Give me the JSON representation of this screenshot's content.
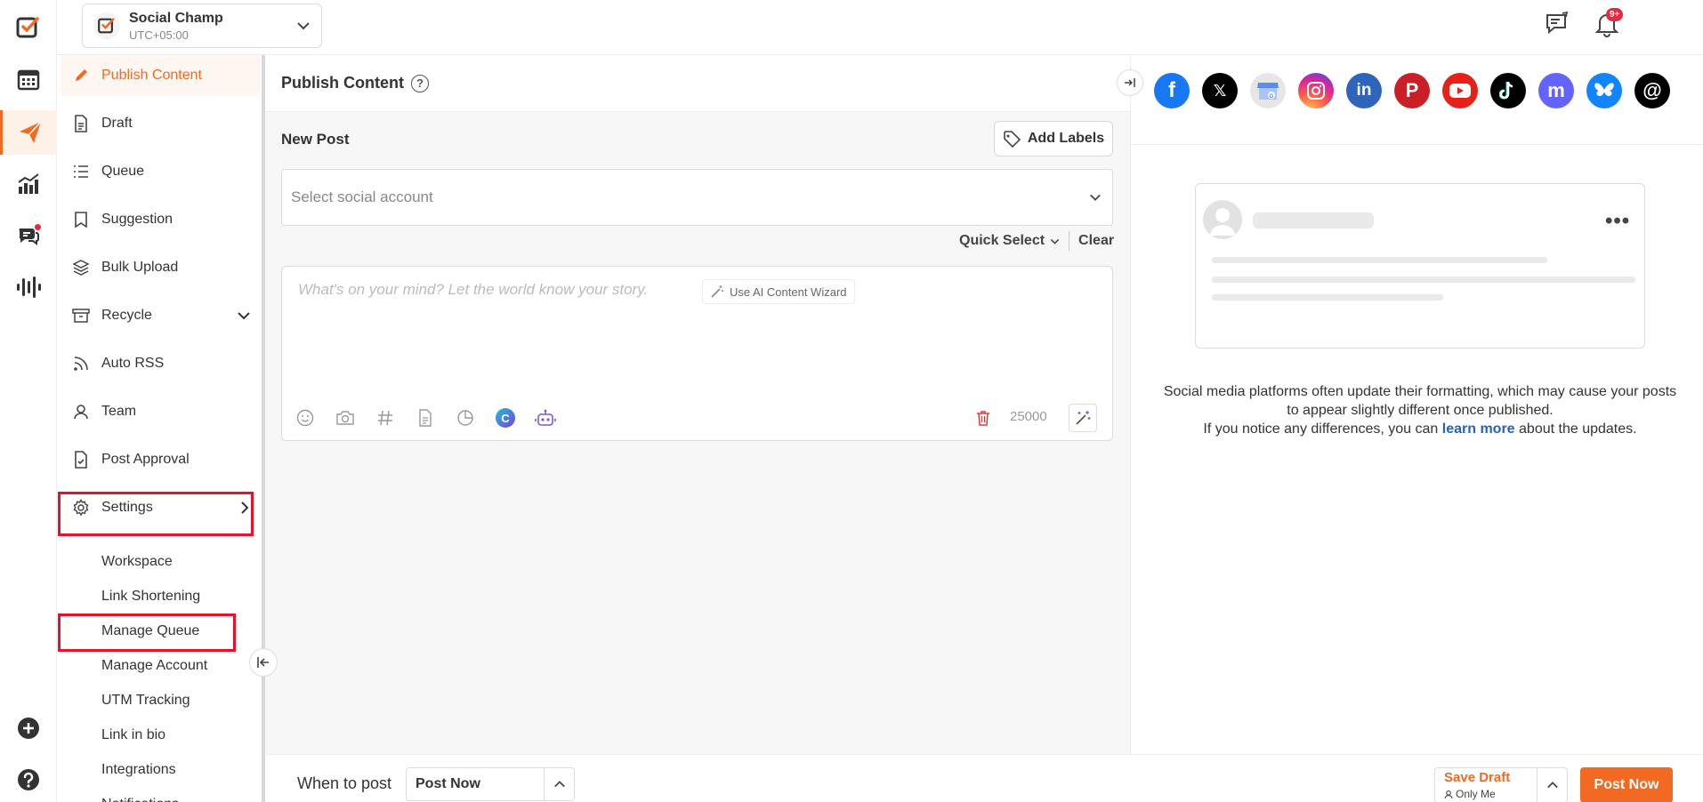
{
  "workspace": {
    "name": "Social Champ",
    "timezone": "UTC+05:00"
  },
  "notifications": {
    "badge": "9+"
  },
  "sidebar": {
    "items": [
      {
        "label": "Publish Content"
      },
      {
        "label": "Draft"
      },
      {
        "label": "Queue"
      },
      {
        "label": "Suggestion"
      },
      {
        "label": "Bulk Upload"
      },
      {
        "label": "Recycle"
      },
      {
        "label": "Auto RSS"
      },
      {
        "label": "Team"
      },
      {
        "label": "Post Approval"
      },
      {
        "label": "Settings"
      }
    ],
    "settings_sub": [
      {
        "label": "Workspace"
      },
      {
        "label": "Link Shortening"
      },
      {
        "label": "Manage Queue"
      },
      {
        "label": "Manage Account"
      },
      {
        "label": "UTM Tracking"
      },
      {
        "label": "Link in bio"
      },
      {
        "label": "Integrations"
      },
      {
        "label": "Notifications"
      }
    ]
  },
  "compose": {
    "title": "Publish Content",
    "help": "?",
    "new_post": "New Post",
    "add_labels": "Add Labels",
    "select_account_placeholder": "Select social account",
    "quick_select": "Quick Select",
    "clear": "Clear",
    "editor_placeholder": "What's on your mind? Let the world know your story.",
    "ai_wizard": "Use AI Content Wizard",
    "char_count": "25000",
    "canva_letter": "C"
  },
  "preview": {
    "note_line1": "Social media platforms often update their formatting, which may cause your posts to appear slightly different once published.",
    "note_line2_pre": "If you notice any differences, you can",
    "note_link": "learn more",
    "note_line2_post": "about the updates.",
    "more": "•••",
    "platform_letters": {
      "facebook": "f",
      "x": "𝕏",
      "linkedin": "in",
      "pinterest": "P",
      "mastodon": "m",
      "threads": "@"
    }
  },
  "bottom": {
    "when_to_post": "When to post",
    "when_value": "Post Now",
    "save_draft": "Save Draft",
    "visibility": "Only Me",
    "post_now": "Post Now"
  },
  "colors": {
    "accent": "#f26a21",
    "highlight": "#e4132a",
    "link": "#2a62b8"
  }
}
